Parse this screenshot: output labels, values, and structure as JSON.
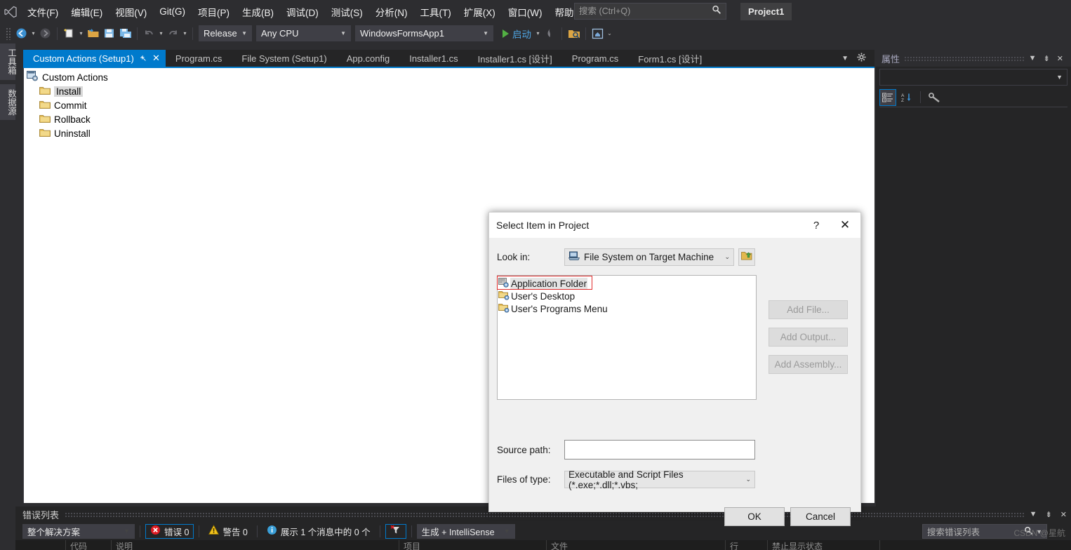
{
  "menubar": {
    "logo_icon": "visual-studio-logo",
    "items": [
      {
        "label": "文件(F)"
      },
      {
        "label": "编辑(E)"
      },
      {
        "label": "视图(V)"
      },
      {
        "label": "Git(G)"
      },
      {
        "label": "项目(P)"
      },
      {
        "label": "生成(B)"
      },
      {
        "label": "调试(D)"
      },
      {
        "label": "测试(S)"
      },
      {
        "label": "分析(N)"
      },
      {
        "label": "工具(T)"
      },
      {
        "label": "扩展(X)"
      },
      {
        "label": "窗口(W)"
      },
      {
        "label": "帮助(H)"
      }
    ],
    "search_placeholder": "搜索 (Ctrl+Q)",
    "search_value": "",
    "search_icon": "magnifier-icon",
    "project_badge": "Project1"
  },
  "toolbar": {
    "nav_back_icon": "navigate-back-icon",
    "nav_forward_icon": "navigate-forward-icon",
    "new_item_icon": "new-file-icon",
    "open_icon": "open-folder-icon",
    "save_icon": "save-icon",
    "save_all_icon": "save-all-icon",
    "undo_icon": "undo-icon",
    "redo_icon": "redo-icon",
    "configuration": "Release",
    "platform": "Any CPU",
    "startup_project": "WindowsFormsApp1",
    "run_label": "启动",
    "hot_reload_icon": "hot-reload-icon",
    "folder_search_icon": "folder-search-icon",
    "live_preview_icon": "live-visual-tree-icon",
    "overflow_icon": "toolbar-overflow-icon"
  },
  "left_dock": {
    "tabs": [
      {
        "label": "工具箱",
        "name": "toolbox"
      },
      {
        "label": "数据源",
        "name": "data-sources"
      }
    ]
  },
  "tabs": {
    "items": [
      {
        "label": "Custom Actions (Setup1)",
        "active": true
      },
      {
        "label": "Program.cs",
        "active": false
      },
      {
        "label": "File System (Setup1)",
        "active": false
      },
      {
        "label": "App.config",
        "active": false
      },
      {
        "label": "Installer1.cs",
        "active": false
      },
      {
        "label": "Installer1.cs [设计]",
        "active": false
      },
      {
        "label": "Program.cs",
        "active": false
      },
      {
        "label": "Form1.cs [设计]",
        "active": false
      }
    ],
    "pin_icon": "pin-icon",
    "close_icon": "close-icon",
    "dropdown_icon": "chevron-down-icon",
    "settings_icon": "gear-icon"
  },
  "editor": {
    "root": {
      "label": "Custom Actions",
      "icon": "custom-actions-icon"
    },
    "nodes": [
      {
        "label": "Install",
        "icon": "folder-icon",
        "selected": true
      },
      {
        "label": "Commit",
        "icon": "folder-icon",
        "selected": false
      },
      {
        "label": "Rollback",
        "icon": "folder-icon",
        "selected": false
      },
      {
        "label": "Uninstall",
        "icon": "folder-icon",
        "selected": false
      }
    ]
  },
  "properties_panel": {
    "title": "属性",
    "dropdown_icon": "chevron-down-icon",
    "pin_icon": "pin-icon",
    "close_icon": "close-icon",
    "object_selector_value": "",
    "toolbar": [
      {
        "name": "categorized-icon",
        "selected": true
      },
      {
        "name": "alphabetical-sort-icon",
        "selected": false
      },
      {
        "name": "properties-wrench-icon",
        "selected": false
      }
    ]
  },
  "error_list": {
    "title": "错误列表",
    "dropdown_icon": "chevron-down-icon",
    "pin_icon": "pin-icon",
    "close_icon": "close-icon",
    "scope_value": "整个解决方案",
    "errors_label": "错误 0",
    "warnings_label": "警告 0",
    "messages_label": "展示 1 个消息中的 0 个",
    "filter_icon": "clear-filter-icon",
    "build_filter_value": "生成 + IntelliSense",
    "search_placeholder": "搜索错误列表",
    "search_icon": "magnifier-icon",
    "columns": [
      "",
      "代码",
      "说明",
      "项目",
      "文件",
      "行",
      "禁止显示状态"
    ]
  },
  "dialog": {
    "title": "Select Item in Project",
    "help_icon": "question-mark-icon",
    "close_icon": "close-icon",
    "look_in_label": "Look in:",
    "look_in_value": "File System on Target Machine",
    "look_in_icon": "computer-icon",
    "up_folder_icon": "up-one-level-icon",
    "list_items": [
      {
        "label": "Application Folder",
        "icon": "application-folder-icon",
        "highlighted": true
      },
      {
        "label": "User's Desktop",
        "icon": "special-folder-icon",
        "highlighted": false
      },
      {
        "label": "User's Programs Menu",
        "icon": "special-folder-icon",
        "highlighted": false
      }
    ],
    "side_buttons": [
      {
        "label": "Add File...",
        "enabled": false
      },
      {
        "label": "Add Output...",
        "enabled": false
      },
      {
        "label": "Add Assembly...",
        "enabled": false
      }
    ],
    "source_path_label": "Source path:",
    "source_path_value": "",
    "files_of_type_label": "Files of type:",
    "files_of_type_value": "Executable and Script Files (*.exe;*.dll;*.vbs;",
    "ok_label": "OK",
    "cancel_label": "Cancel"
  },
  "watermark": "CSDN @星航",
  "colors": {
    "accent": "#007acc",
    "chrome": "#2d2d30",
    "panel": "#252526",
    "dialog_bg": "#f0f0f0",
    "highlight_red": "#e02b2b",
    "run_green": "#52b043"
  }
}
